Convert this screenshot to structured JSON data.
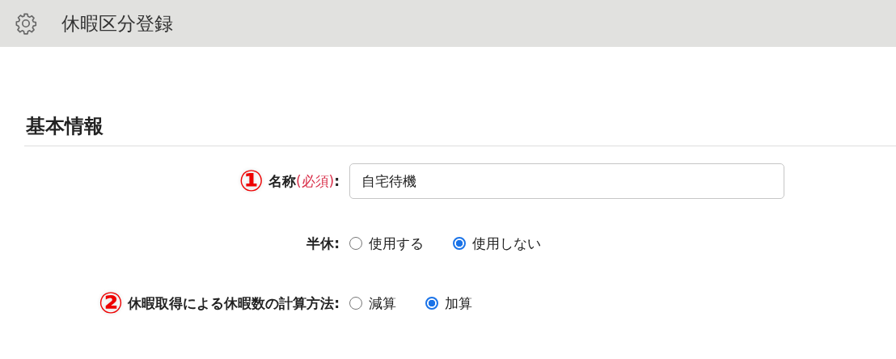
{
  "header": {
    "title": "休暇区分登録"
  },
  "section": {
    "title": "基本情報"
  },
  "fields": [
    {
      "kind": "text",
      "marker": "①",
      "label": "名称",
      "required": "(必須)",
      "colon": ":",
      "value": "自宅待機"
    },
    {
      "kind": "radio",
      "label": "半休",
      "colon": ":",
      "options": [
        {
          "label": "使用する",
          "selected": false
        },
        {
          "label": "使用しない",
          "selected": true
        }
      ]
    },
    {
      "kind": "radio",
      "marker": "②",
      "label": "休暇取得による休暇数の計算方法",
      "colon": ":",
      "options": [
        {
          "label": "減算",
          "selected": false
        },
        {
          "label": "加算",
          "selected": true
        }
      ]
    }
  ]
}
